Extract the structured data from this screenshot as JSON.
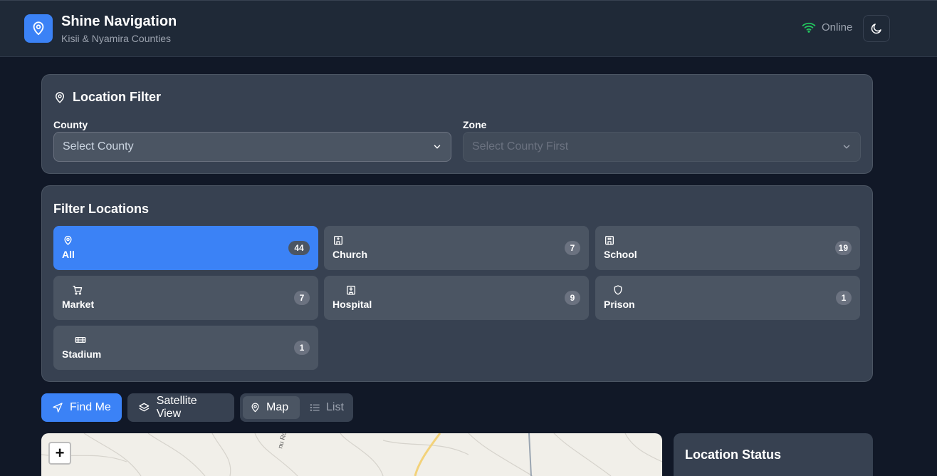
{
  "header": {
    "title": "Shine Navigation",
    "subtitle": "Kisii & Nyamira Counties",
    "status": "Online",
    "status_color": "#22c55e"
  },
  "location_filter": {
    "title": "Location Filter",
    "county": {
      "label": "County",
      "placeholder": "Select County"
    },
    "zone": {
      "label": "Zone",
      "placeholder": "Select County First"
    }
  },
  "filter_locations": {
    "title": "Filter Locations",
    "items": [
      {
        "label": "All",
        "count": "44",
        "icon": "map-pin-icon",
        "active": true
      },
      {
        "label": "Church",
        "count": "7",
        "icon": "church-icon",
        "active": false
      },
      {
        "label": "School",
        "count": "19",
        "icon": "school-icon",
        "active": false
      },
      {
        "label": "Market",
        "count": "7",
        "icon": "cart-icon",
        "active": false
      },
      {
        "label": "Hospital",
        "count": "9",
        "icon": "hospital-icon",
        "active": false
      },
      {
        "label": "Prison",
        "count": "1",
        "icon": "shield-icon",
        "active": false
      },
      {
        "label": "Stadium",
        "count": "1",
        "icon": "stadium-icon",
        "active": false
      }
    ]
  },
  "actions": {
    "find_me": "Find Me",
    "satellite": "Satellite View",
    "map": "Map",
    "list": "List"
  },
  "map": {
    "zoom_in": "+",
    "road_label": "nu Road"
  },
  "location_status": {
    "title": "Location Status"
  },
  "colors": {
    "accent": "#3b82f6",
    "background": "#111827",
    "card": "#374151"
  }
}
